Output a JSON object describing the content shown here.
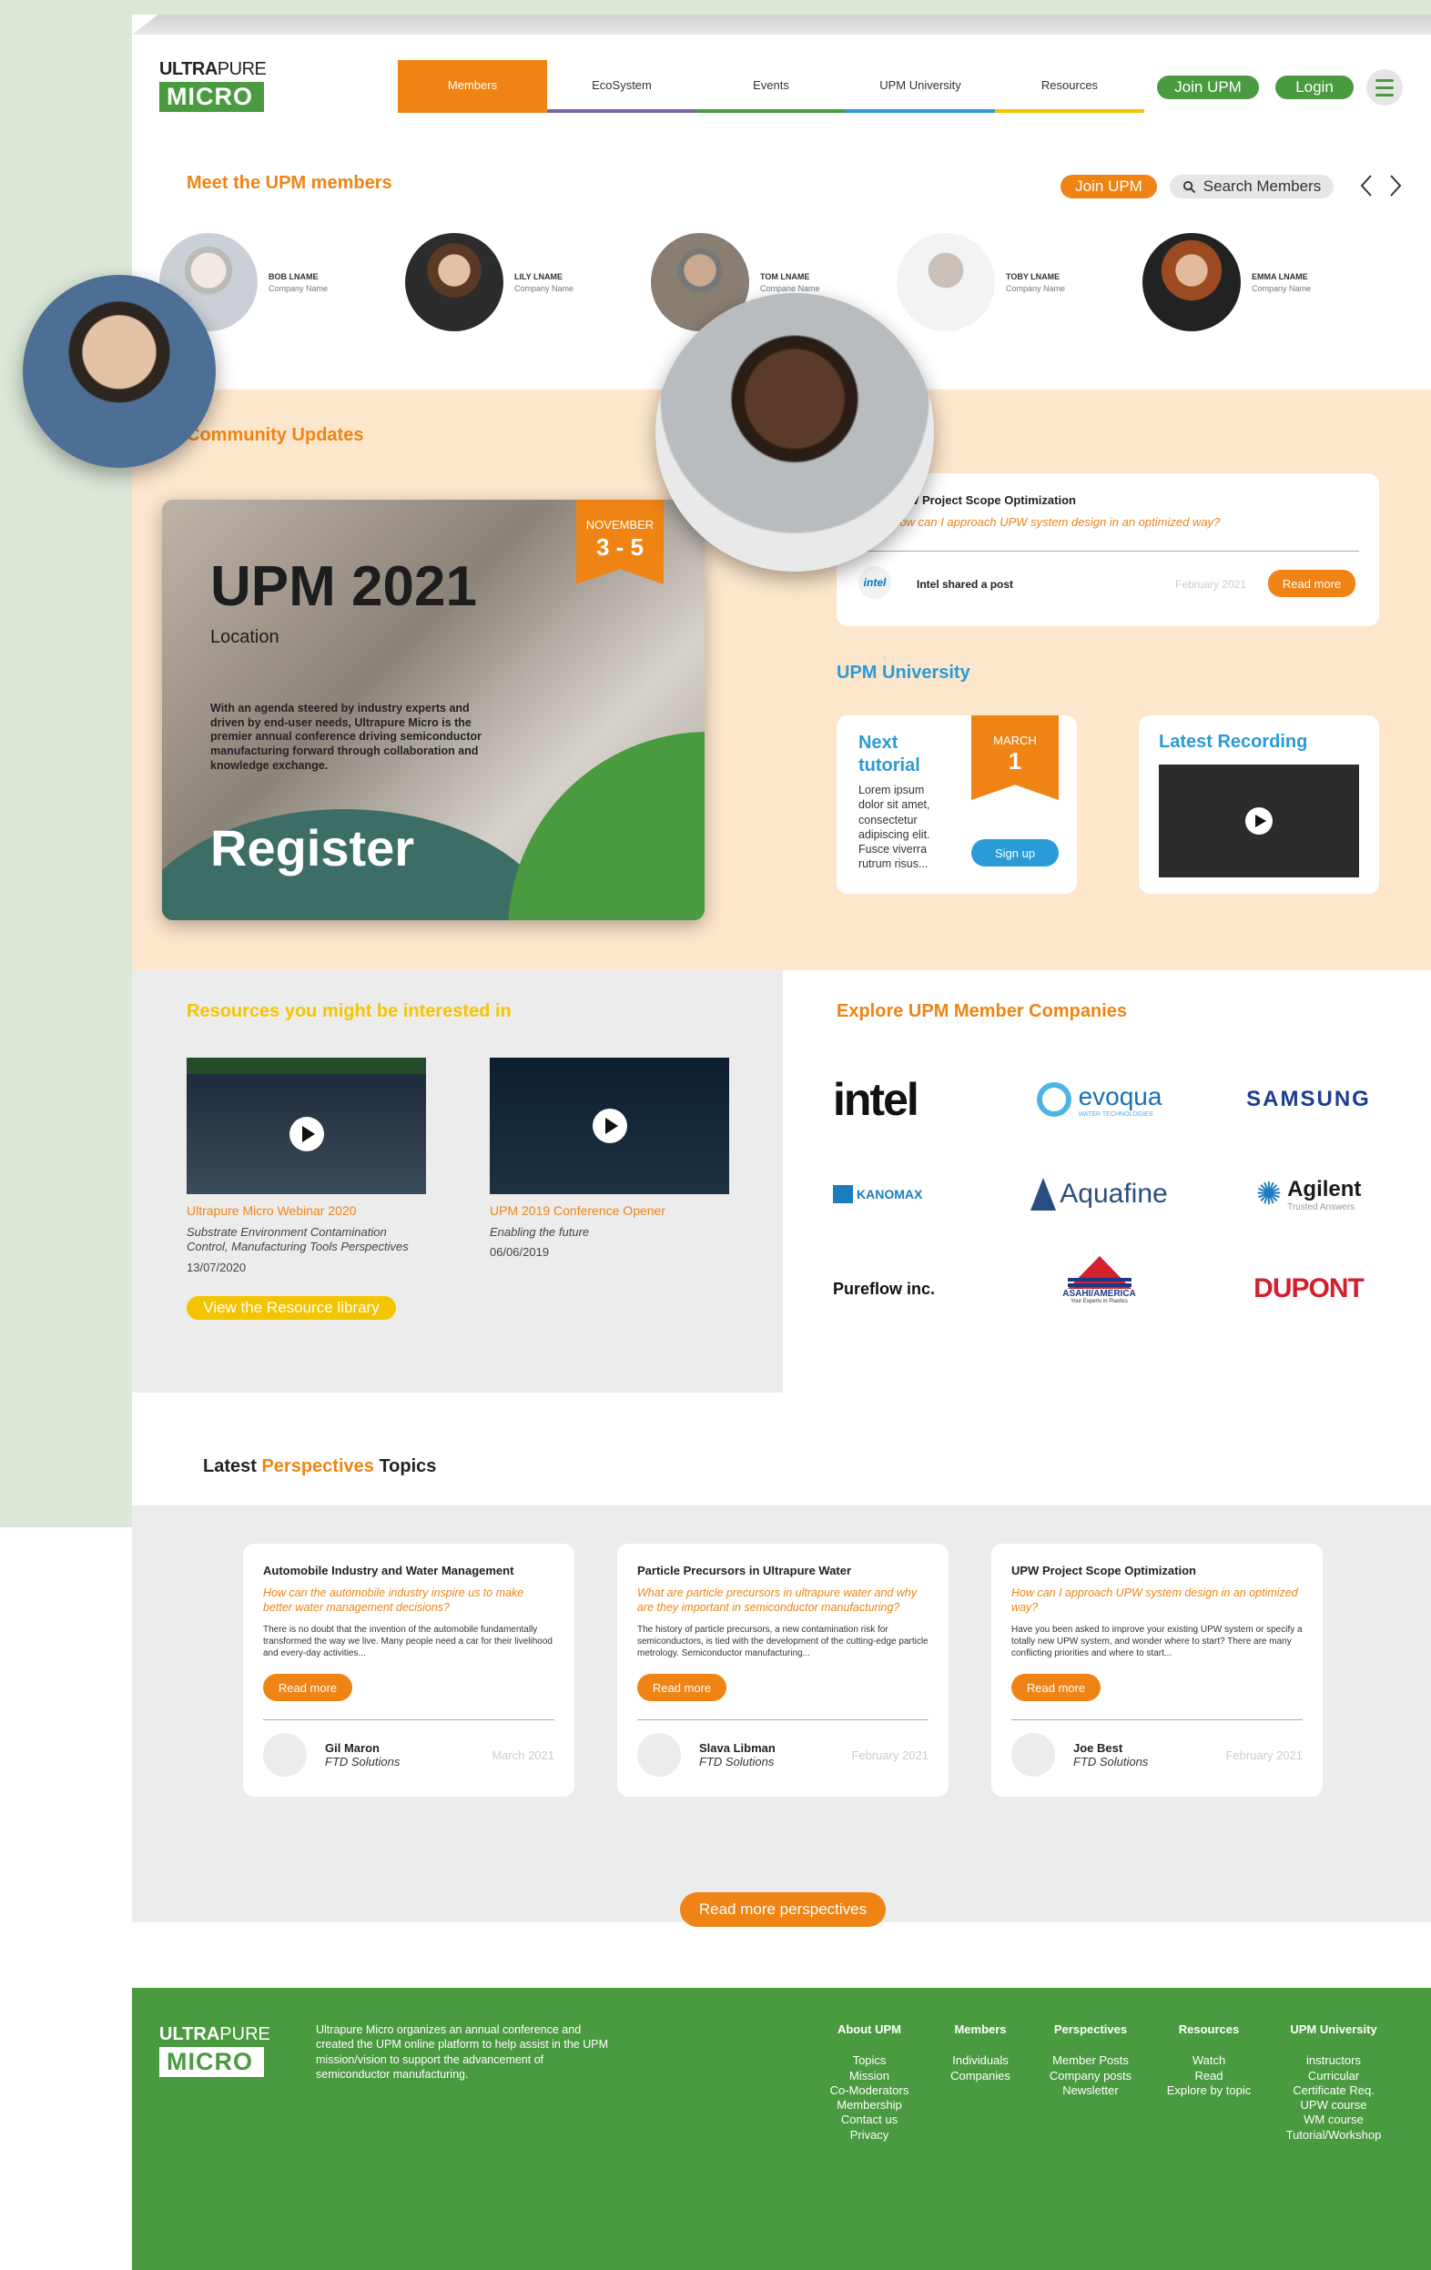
{
  "brand": {
    "top_bold": "ULTRA",
    "top_light": "PURE",
    "box": "MICRO"
  },
  "nav": [
    {
      "label": "Members",
      "color": "#ef8414"
    },
    {
      "label": "EcoSystem",
      "color": "#7b62a4"
    },
    {
      "label": "Events",
      "color": "#4a9a40"
    },
    {
      "label": "UPM University",
      "color": "#2a9bd6"
    },
    {
      "label": "Resources",
      "color": "#f5c400"
    }
  ],
  "header_buttons": {
    "join": "Join UPM",
    "login": "Login"
  },
  "members_section": {
    "title": "Meet the UPM members",
    "join_label": "Join UPM",
    "search_label": "Search Members",
    "prev": "‹",
    "next": "›",
    "items": [
      {
        "name": "BOB LNAME",
        "company": "Company Name"
      },
      {
        "name": "LILY LNAME",
        "company": "Company Name"
      },
      {
        "name": "TOM LNAME",
        "company": "Compane Name"
      },
      {
        "name": "TOBY LNAME",
        "company": "Company Name"
      },
      {
        "name": "EMMA LNAME",
        "company": "Company Name"
      }
    ]
  },
  "community": {
    "title": "Community Updates",
    "event": {
      "title": "UPM 2021",
      "location": "Location",
      "month": "NOVEMBER",
      "days": "3 - 5",
      "description": "With an agenda steered by industry experts and driven by end-user needs, Ultrapure Micro is the premier annual conference driving semiconductor manufacturing forward through collaboration and knowledge exchange.",
      "cta": "Register"
    },
    "post": {
      "title": "UPW Project Scope Optimization",
      "question": "How can I approach UPW system design in an optimized way?",
      "author_logo": "intel",
      "shared": "Intel shared a post",
      "date": "February 2021",
      "read_more": "Read more"
    }
  },
  "university": {
    "title": "UPM University",
    "tutorial": {
      "title_1": "Next",
      "title_2": "tutorial",
      "text": "Lorem ipsum dolor sit amet, consectetur adipiscing elit. Fusce viverra rutrum risus...",
      "month": "MARCH",
      "day": "1",
      "signup": "Sign up"
    },
    "recording": {
      "title": "Latest Recording"
    }
  },
  "resources": {
    "title": "Resources you might be interested in",
    "items": [
      {
        "title": "Ultrapure Micro Webinar 2020",
        "desc": "Substrate Environment Contamination Control, Manufacturing Tools Perspectives",
        "date": "13/07/2020"
      },
      {
        "title": "UPM 2019 Conference Opener",
        "desc": "Enabling the future",
        "date": "06/06/2019"
      }
    ],
    "library_button": "View the Resource library"
  },
  "companies": {
    "title": "Explore UPM Member Companies",
    "logos": [
      {
        "name": "intel",
        "color": "#111111"
      },
      {
        "name": "evoqua",
        "color": "#1a6fb7",
        "sub": "WATER TECHNOLOGIES"
      },
      {
        "name": "SAMSUNG",
        "color": "#1a3d91"
      },
      {
        "name": "KANOMAX",
        "color": "#1c7cc0"
      },
      {
        "name": "Aquafine",
        "color": "#2a4d80"
      },
      {
        "name": "Agilent",
        "color": "#1a1a1a",
        "sub": "Trusted Answers"
      },
      {
        "name": "Pureflow inc.",
        "color": "#111111"
      },
      {
        "name": "ASAHI/AMERICA",
        "color": "#1b3a84",
        "sub": "Your Experts in Plastics"
      },
      {
        "name": "DUPONT",
        "color": "#d1202e"
      }
    ]
  },
  "perspectives": {
    "heading_start": "Latest ",
    "heading_accent": "Perspectives",
    "heading_end": " Topics",
    "items": [
      {
        "title": "Automobile Industry and Water Management",
        "question": "How can the automobile industry inspire us to make better water management decisions?",
        "body": "There is no doubt that the invention of the automobile fundamentally transformed the way we live. Many people need a car for their livelihood and every-day activities...",
        "read_more": "Read more",
        "author": "Gil Maron",
        "company": "FTD Solutions",
        "date": "March 2021"
      },
      {
        "title": "Particle Precursors in Ultrapure Water",
        "question": "What are particle precursors in ultrapure water and why are they important in semiconductor manufacturing?",
        "body": "The history of particle precursors, a new contamination risk for semiconductors, is tied with the development of the cutting-edge particle metrology. Semiconductor manufacturing...",
        "read_more": "Read more",
        "author": "Slava Libman",
        "company": "FTD Solutions",
        "date": "February 2021"
      },
      {
        "title": "UPW Project Scope Optimization",
        "question": "How can I approach UPW system design in an optimized way?",
        "body": "Have you been asked to improve your existing UPW system or specify a totally new UPW system, and wonder where to start? There are many conflicting priorities and where to start...",
        "read_more": "Read more",
        "author": "Joe Best",
        "company": "FTD Solutions",
        "date": "February 2021"
      }
    ],
    "more_button": "Read more perspectives"
  },
  "footer": {
    "about": "Ultrapure Micro organizes an annual conference and created the UPM online platform to help assist in the UPM mission/vision to support the advancement of semiconductor manufacturing.",
    "columns": [
      {
        "heading": "About UPM",
        "links": [
          "Topics",
          "Mission",
          "Co-Moderators",
          "Membership",
          "Contact us",
          "Privacy"
        ]
      },
      {
        "heading": "Members",
        "links": [
          "Individuals",
          "Companies"
        ]
      },
      {
        "heading": "Perspectives",
        "links": [
          "Member Posts",
          "Company posts",
          "Newsletter"
        ]
      },
      {
        "heading": "Resources",
        "links": [
          "Watch",
          "Read",
          "Explore by topic"
        ]
      },
      {
        "heading": "UPM University",
        "links": [
          "instructors",
          "Curricular",
          "Certificate Req.",
          "UPW course",
          "WM course",
          "Tutorial/Workshop"
        ]
      }
    ]
  }
}
